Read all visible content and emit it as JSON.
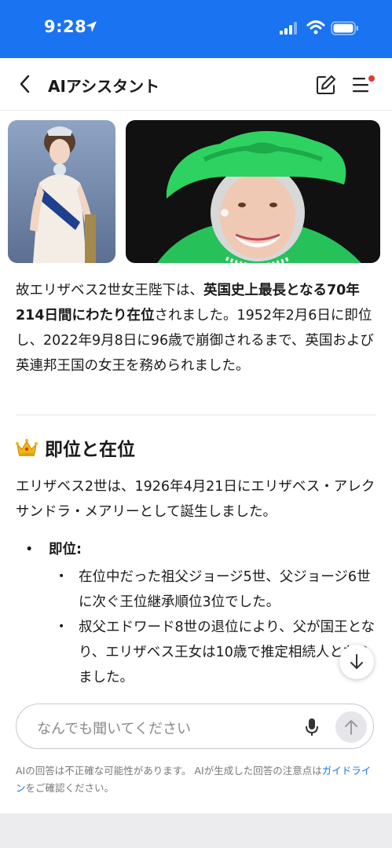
{
  "status_bar": {
    "time": "9:28"
  },
  "header": {
    "title": "AIアシスタント"
  },
  "intro": {
    "part1": "故エリザベス2世女王陛下は、",
    "bold": "英国史上最長となる70年214日間にわたり在位",
    "part2": "されました。1952年2月6日に即位し、2022年9月8日に96歳で崩御されるまで、英国および英連邦王国の女王を務められました。"
  },
  "section": {
    "heading": "即位と在位",
    "body": "エリザベス2世は、1926年4月21日にエリザベス・アレクサンドラ・メアリーとして誕生しました。",
    "bullet_title": "即位:",
    "sub_items": [
      "在位中だった祖父ジョージ5世、父ジョージ6世に次ぐ王位継承順位3位でした。",
      "叔父エドワード8世の退位により、父が国王となり、エリザベス王女は10歳で推定相続人となりました。"
    ]
  },
  "composer": {
    "placeholder": "なんでも聞いてください"
  },
  "disclaimer": {
    "text1": "AIの回答は不正確な可能性があります。 AIが生成した回答の注意点は",
    "link": "ガイドライン",
    "text2": "をご確認ください。"
  },
  "colors": {
    "accent": "#1a73f0",
    "hat_green": "#2ecc5a",
    "notify_dot": "#e53935"
  }
}
